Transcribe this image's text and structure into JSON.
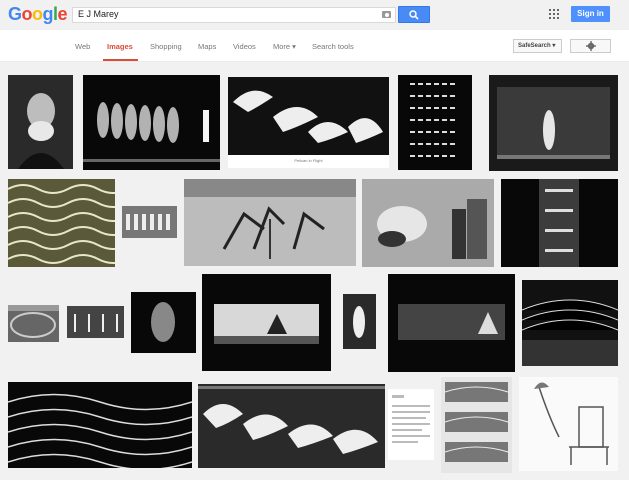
{
  "logo": {
    "letters": [
      "G",
      "o",
      "o",
      "g",
      "l",
      "e"
    ],
    "colors": [
      "#4285f4",
      "#ea4335",
      "#fbbc05",
      "#4285f4",
      "#34a853",
      "#ea4335"
    ]
  },
  "search": {
    "query": "E J Marey"
  },
  "header": {
    "signin_label": "Sign in"
  },
  "nav": {
    "items": [
      "Web",
      "Images",
      "Shopping",
      "Maps",
      "Videos",
      "More ▾",
      "Search tools"
    ],
    "active": "Images",
    "safesearch_label": "SafeSearch ▾"
  },
  "results": {
    "caption_pelican": "Pelican in Flight",
    "thumbnails": [
      "portrait-marey",
      "running-figures",
      "pelicans-flight",
      "dash-pattern",
      "walking-figure",
      "fabric-pattern",
      "figures-row",
      "pole-vault",
      "painter-smoke",
      "chronophoto-vertical",
      "round-track",
      "hurdles",
      "figure-small",
      "horse-rider",
      "standing-figure",
      "horse-track",
      "wave-lines",
      "line-sculpture",
      "birds-flight",
      "document-page",
      "graph-strips",
      "apparatus-drawing"
    ]
  },
  "colors": {
    "accent": "#dd4b39",
    "button_blue": "#4a8af4"
  }
}
